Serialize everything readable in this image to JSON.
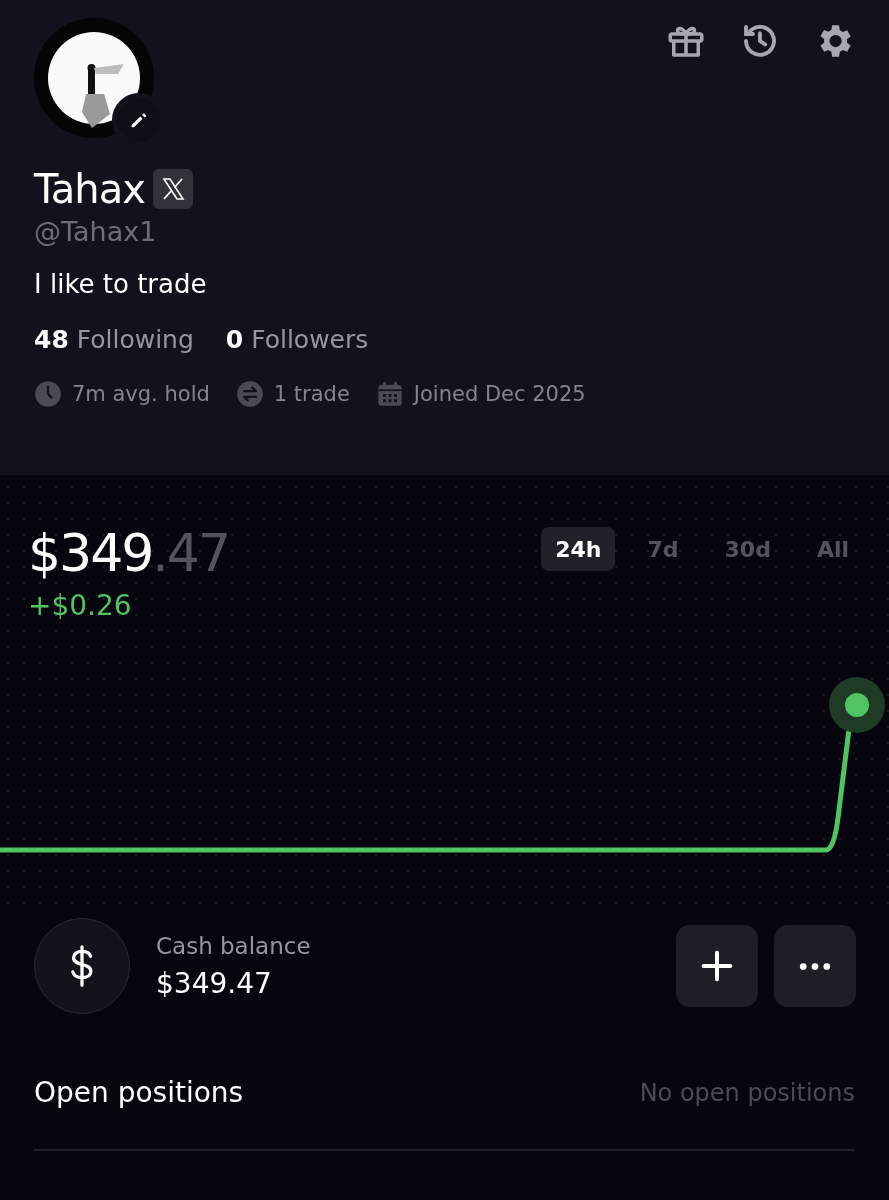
{
  "profile": {
    "avatar": {
      "kind": "picture"
    },
    "name": "Tahax",
    "handle": "@Tahax1",
    "bio": "I like to trade",
    "counts": [
      "**48** Following",
      "**0** Followers"
    ],
    "stats": [
      {
        "kind": "clock",
        "text": "7m avg. hold"
      },
      {
        "kind": "swap",
        "text": "1 trade"
      },
      {
        "kind": "calendar",
        "text": "Joined Dec 2025"
      }
    ]
  },
  "portfolio": {
    "value_whole": "$349",
    "value_cents": ".47",
    "change": "+$0.26",
    "ranges": [
      {
        "label": "24h",
        "selected": true
      },
      {
        "label": "7d",
        "selected": false
      },
      {
        "label": "30d",
        "selected": false
      },
      {
        "label": "All",
        "selected": false
      }
    ]
  },
  "cash": {
    "label": "Cash balance",
    "amount": "$349.47"
  },
  "open_positions": {
    "title": "Open positions",
    "empty_text": "No open positions"
  }
}
